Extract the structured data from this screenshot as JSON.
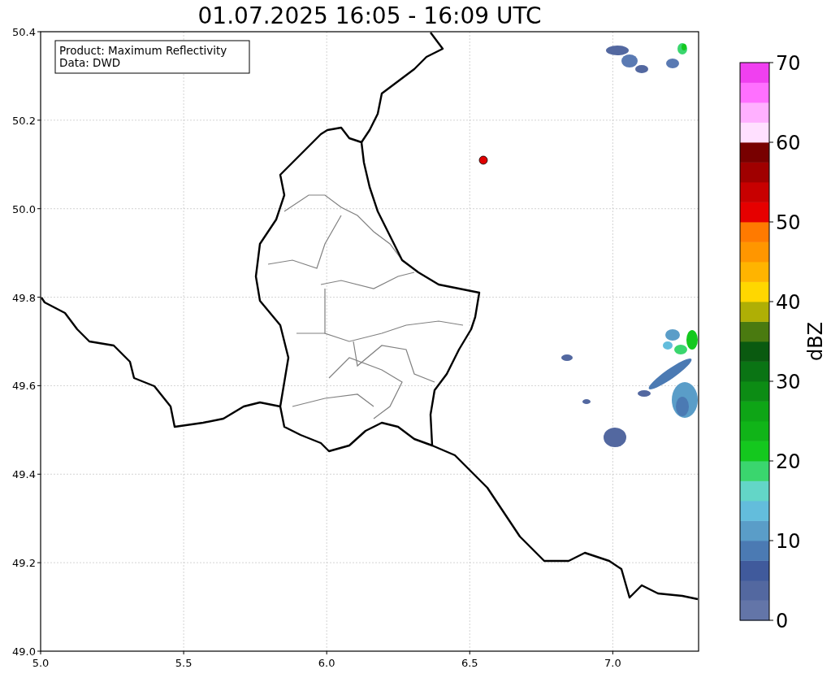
{
  "title": "01.07.2025 16:05 - 16:09 UTC",
  "info_box": {
    "lines": [
      "Product: Maximum Reflectivity",
      "Data: DWD"
    ]
  },
  "map": {
    "xticks": [
      "5.0",
      "5.5",
      "6.0",
      "6.5",
      "7.0"
    ],
    "yticks": [
      "50.4",
      "50.2",
      "50.0",
      "49.8",
      "49.6",
      "49.4",
      "49.2",
      "49.0"
    ]
  },
  "colorbar": {
    "label": "dBZ",
    "ticks": [
      "70",
      "60",
      "50",
      "40",
      "30",
      "20",
      "10",
      "0"
    ],
    "bins": [
      {
        "color": "#6375a8"
      },
      {
        "color": "#5368a0"
      },
      {
        "color": "#405a9c"
      },
      {
        "color": "#4b7ab3"
      },
      {
        "color": "#5a9dc8"
      },
      {
        "color": "#63bddc"
      },
      {
        "color": "#63d6c7"
      },
      {
        "color": "#3ad66e"
      },
      {
        "color": "#14c81e"
      },
      {
        "color": "#10b418"
      },
      {
        "color": "#0ea516"
      },
      {
        "color": "#0c8c14"
      },
      {
        "color": "#0a7414"
      },
      {
        "color": "#0a5a10"
      },
      {
        "color": "#4a7a10"
      },
      {
        "color": "#afaf05"
      },
      {
        "color": "#ffd700"
      },
      {
        "color": "#ffb400"
      },
      {
        "color": "#ff9600"
      },
      {
        "color": "#ff7a00"
      },
      {
        "color": "#e60000"
      },
      {
        "color": "#c80000"
      },
      {
        "color": "#a00000"
      },
      {
        "color": "#780000"
      },
      {
        "color": "#ffe0ff"
      },
      {
        "color": "#ffb0ff"
      },
      {
        "color": "#ff70ff"
      },
      {
        "color": "#f040f0"
      }
    ]
  }
}
